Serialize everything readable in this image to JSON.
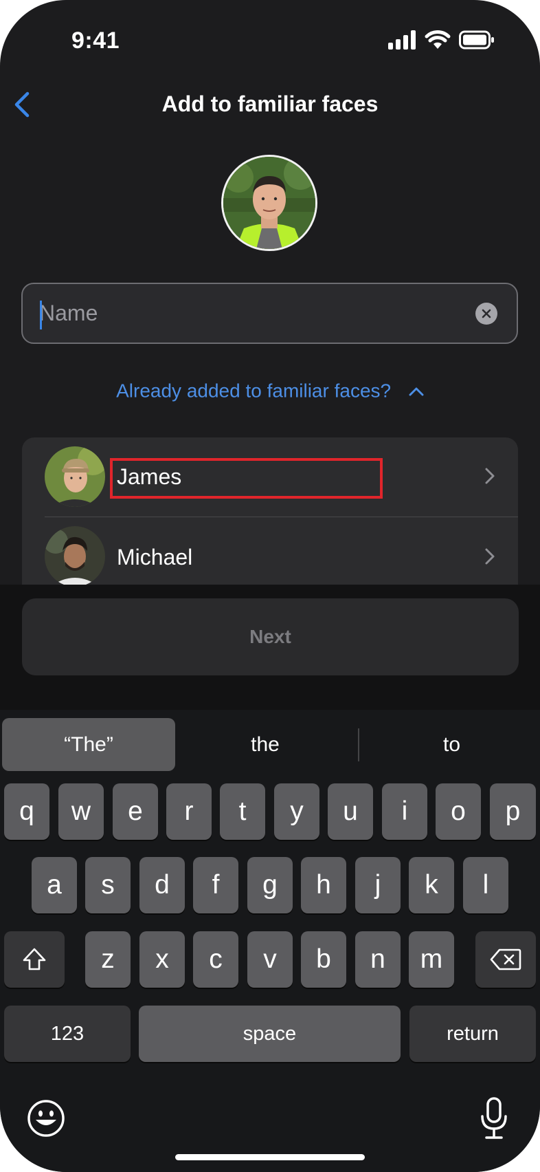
{
  "status_bar": {
    "time": "9:41"
  },
  "nav": {
    "title": "Add to familiar faces"
  },
  "name_field": {
    "placeholder": "Name",
    "value": ""
  },
  "already_added": {
    "label": "Already added to familiar faces?"
  },
  "people": [
    {
      "name": "James"
    },
    {
      "name": "Michael"
    }
  ],
  "next_button": {
    "label": "Next"
  },
  "keyboard": {
    "suggestions": [
      "“The”",
      "the",
      "to"
    ],
    "rows": [
      [
        "q",
        "w",
        "e",
        "r",
        "t",
        "y",
        "u",
        "i",
        "o",
        "p"
      ],
      [
        "a",
        "s",
        "d",
        "f",
        "g",
        "h",
        "j",
        "k",
        "l"
      ],
      [
        "z",
        "x",
        "c",
        "v",
        "b",
        "n",
        "m"
      ]
    ],
    "numbers_key": "123",
    "space_key": "space",
    "return_key": "return"
  },
  "colors": {
    "accent": "#4d8fe6",
    "highlight_box": "#e0252b",
    "background": "#1c1c1e"
  },
  "icons": [
    "back-chevron-icon",
    "clear-icon",
    "chevron-up-icon",
    "chevron-right-icon",
    "shift-icon",
    "backspace-icon",
    "emoji-icon",
    "microphone-icon",
    "cellular-signal-icon",
    "wifi-icon",
    "battery-icon"
  ]
}
